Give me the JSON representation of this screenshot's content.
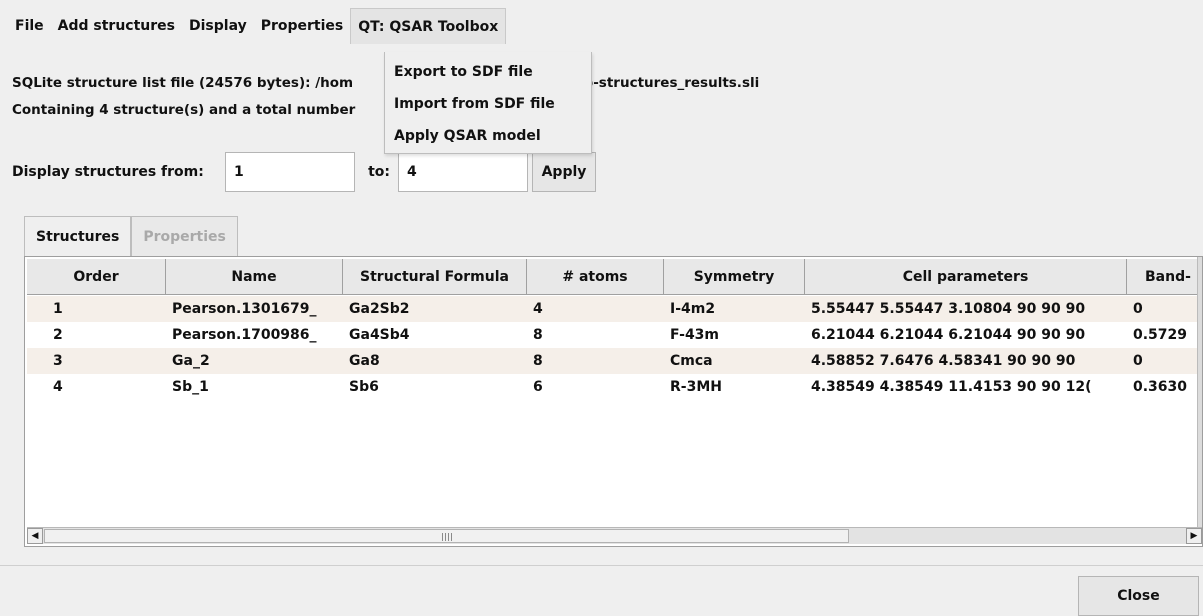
{
  "menubar": {
    "items": [
      "File",
      "Add structures",
      "Display",
      "Properties",
      "QT: QSAR Toolbox"
    ]
  },
  "dropdown": {
    "items": [
      "Export to SDF file",
      "Import from SDF file",
      "Apply QSAR model"
    ]
  },
  "info": {
    "line1_prefix": "SQLite structure list file (24576 bytes):  /hom",
    "line1_suffix": "a-Sb-structures_results.sli",
    "line2": "Containing 4 structure(s) and a total number"
  },
  "range": {
    "from_label": "Display structures from:",
    "from_value": "1",
    "to_label": "to:",
    "to_value": "4",
    "apply_label": "Apply"
  },
  "tabs": {
    "structures": "Structures",
    "properties": "Properties"
  },
  "table": {
    "columns": [
      "Order",
      "Name",
      "Structural Formula",
      "# atoms",
      "Symmetry",
      "Cell parameters",
      "Band-"
    ],
    "rows": [
      [
        "1",
        "Pearson.1301679_",
        "Ga2Sb2",
        "4",
        "I-4m2",
        "5.55447 5.55447 3.10804 90 90 90",
        "0"
      ],
      [
        "2",
        "Pearson.1700986_",
        "Ga4Sb4",
        "8",
        "F-43m",
        "6.21044 6.21044 6.21044 90 90 90",
        "0.5729"
      ],
      [
        "3",
        "Ga_2",
        "Ga8",
        "8",
        "Cmca",
        "4.58852 7.6476 4.58341 90 90 90",
        "0"
      ],
      [
        "4",
        "Sb_1",
        "Sb6",
        "6",
        "R-3MH",
        "4.38549 4.38549 11.4153 90 90 12(",
        "0.3630"
      ]
    ]
  },
  "footer": {
    "close_label": "Close"
  },
  "icons": {
    "scroll_left": "arrow-left-icon",
    "scroll_right": "arrow-right-icon"
  }
}
